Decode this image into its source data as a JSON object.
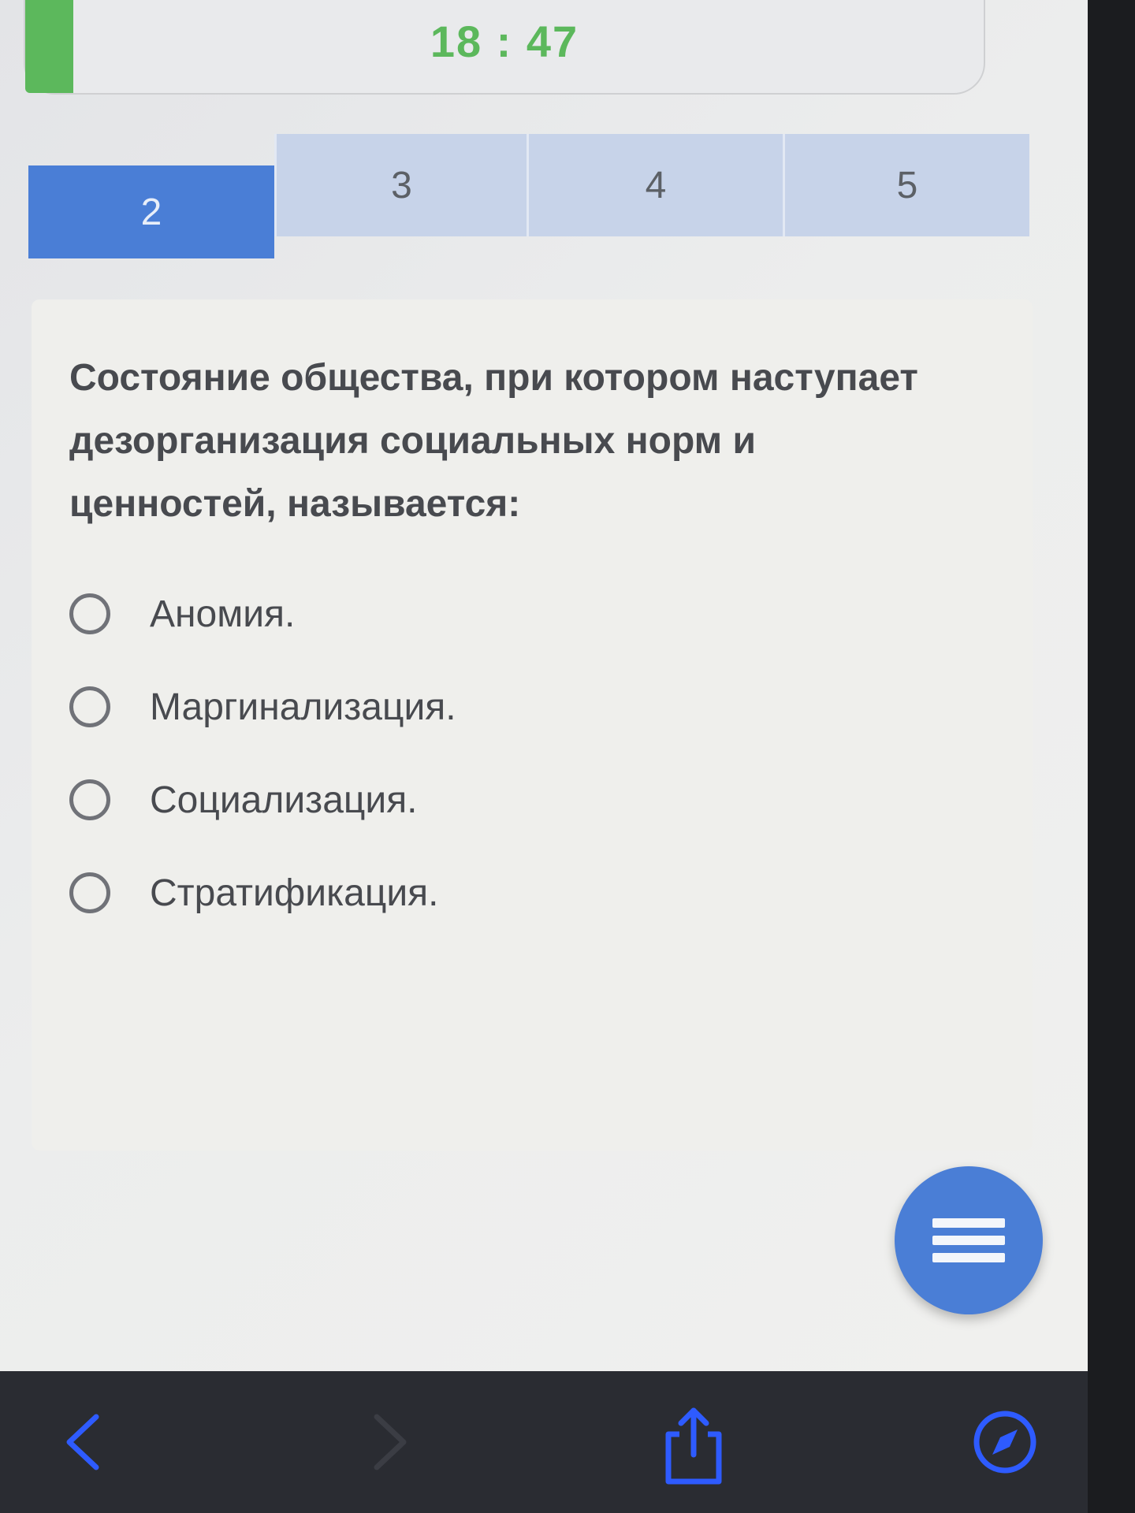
{
  "timer": {
    "text": "18 : 47",
    "progress": 0.05,
    "color": "#5cb85c"
  },
  "tabs": [
    {
      "label": "2",
      "active": true
    },
    {
      "label": "3",
      "active": false
    },
    {
      "label": "4",
      "active": false
    },
    {
      "label": "5",
      "active": false
    }
  ],
  "question": {
    "text": "Состояние общества, при котором наступает дезорганизация социальных норм и ценностей, называется:",
    "options": [
      {
        "label": "Аномия."
      },
      {
        "label": "Маргинализация."
      },
      {
        "label": "Социализация."
      },
      {
        "label": "Стратификация."
      }
    ]
  },
  "fab": {
    "icon": "menu-icon",
    "color": "#4a7ed6"
  },
  "bottom_bar": {
    "icons": [
      "back-icon",
      "forward-icon",
      "share-icon",
      "compass-icon"
    ],
    "accent": "#2e5bff"
  }
}
